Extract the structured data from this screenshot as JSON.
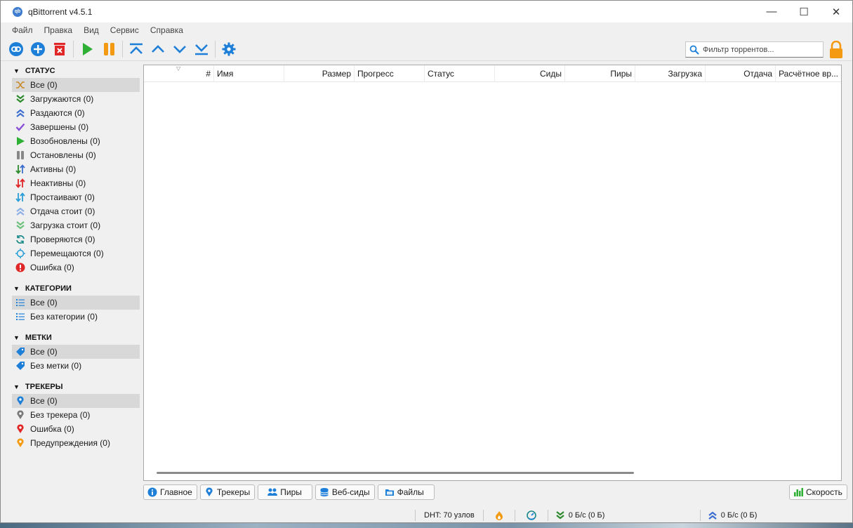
{
  "window": {
    "title": "qBittorrent v4.5.1",
    "app_icon_text": "qb",
    "controls": {
      "minimize": "—",
      "maximize": "☐",
      "close": "✕"
    }
  },
  "menu": [
    "Файл",
    "Правка",
    "Вид",
    "Сервис",
    "Справка"
  ],
  "toolbar": {
    "buttons": [
      "add-link",
      "add-torrent",
      "remove",
      "resume",
      "pause",
      "move-top",
      "move-up",
      "move-down",
      "move-bottom",
      "settings"
    ],
    "search_placeholder": "Фильтр торрентов..."
  },
  "sidebar": {
    "status": {
      "header": "СТАТУС",
      "items": [
        {
          "label": "Все (0)",
          "icon": "shuffle-icon",
          "selected": true
        },
        {
          "label": "Загружаются (0)",
          "icon": "double-down-icon"
        },
        {
          "label": "Раздаются (0)",
          "icon": "double-up-icon"
        },
        {
          "label": "Завершены (0)",
          "icon": "check-icon"
        },
        {
          "label": "Возобновлены (0)",
          "icon": "play-icon"
        },
        {
          "label": "Остановлены (0)",
          "icon": "pause-icon"
        },
        {
          "label": "Активны (0)",
          "icon": "updown-active-icon"
        },
        {
          "label": "Неактивны (0)",
          "icon": "updown-inactive-icon"
        },
        {
          "label": "Простаивают (0)",
          "icon": "updown-stalled-icon"
        },
        {
          "label": "Отдача стоит (0)",
          "icon": "upload-stalled-icon"
        },
        {
          "label": "Загрузка стоит (0)",
          "icon": "download-stalled-icon"
        },
        {
          "label": "Проверяются (0)",
          "icon": "refresh-icon"
        },
        {
          "label": "Перемещаются (0)",
          "icon": "move-icon"
        },
        {
          "label": "Ошибка (0)",
          "icon": "error-icon"
        }
      ]
    },
    "categories": {
      "header": "КАТЕГОРИИ",
      "items": [
        {
          "label": "Все (0)",
          "icon": "list-icon",
          "selected": true
        },
        {
          "label": "Без категории (0)",
          "icon": "list-icon"
        }
      ]
    },
    "tags": {
      "header": "МЕТКИ",
      "items": [
        {
          "label": "Все (0)",
          "icon": "tag-icon",
          "selected": true
        },
        {
          "label": "Без метки (0)",
          "icon": "tag-icon"
        }
      ]
    },
    "trackers": {
      "header": "ТРЕКЕРЫ",
      "items": [
        {
          "label": "Все (0)",
          "icon": "pin-blue-icon",
          "selected": true
        },
        {
          "label": "Без трекера (0)",
          "icon": "pin-gray-icon"
        },
        {
          "label": "Ошибка (0)",
          "icon": "pin-red-icon"
        },
        {
          "label": "Предупреждения (0)",
          "icon": "pin-orange-icon"
        }
      ]
    }
  },
  "table": {
    "columns": [
      "#",
      "Имя",
      "Размер",
      "Прогресс",
      "Статус",
      "Сиды",
      "Пиры",
      "Загрузка",
      "Отдача",
      "Расчётное вр..."
    ],
    "rows": []
  },
  "bottom_tabs": [
    "Главное",
    "Трекеры",
    "Пиры",
    "Веб-сиды",
    "Файлы"
  ],
  "speed_button": "Скорость",
  "statusbar": {
    "dht": "DHT: 70 узлов",
    "download": "0 Б/с (0 Б)",
    "upload": "0 Б/с (0 Б)"
  },
  "colors": {
    "accent_blue": "#1e7fd8",
    "green": "#2db034",
    "orange": "#f39a12",
    "red": "#e02626"
  }
}
